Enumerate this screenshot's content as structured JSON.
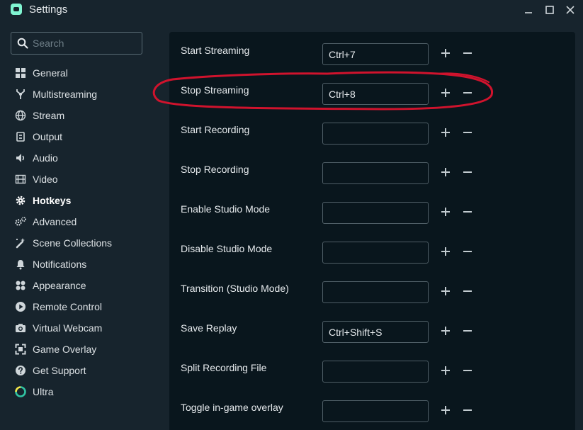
{
  "window": {
    "title": "Settings",
    "icons": {
      "app": "streamlabs-logo-icon",
      "minimize": "minimize-icon",
      "maximize": "maximize-icon",
      "close": "close-icon"
    }
  },
  "search": {
    "placeholder": "Search",
    "value": "",
    "icon": "search-icon"
  },
  "sidebar": {
    "active": "Hotkeys",
    "items": [
      {
        "label": "General",
        "icon": "grid-icon"
      },
      {
        "label": "Multistreaming",
        "icon": "fork-icon"
      },
      {
        "label": "Stream",
        "icon": "globe-icon"
      },
      {
        "label": "Output",
        "icon": "output-icon"
      },
      {
        "label": "Audio",
        "icon": "speaker-icon"
      },
      {
        "label": "Video",
        "icon": "film-icon"
      },
      {
        "label": "Hotkeys",
        "icon": "gear-icon"
      },
      {
        "label": "Advanced",
        "icon": "gears-icon"
      },
      {
        "label": "Scene Collections",
        "icon": "magic-wand-icon"
      },
      {
        "label": "Notifications",
        "icon": "bell-icon"
      },
      {
        "label": "Appearance",
        "icon": "palette-icon"
      },
      {
        "label": "Remote Control",
        "icon": "play-circle-icon"
      },
      {
        "label": "Virtual Webcam",
        "icon": "camera-icon"
      },
      {
        "label": "Game Overlay",
        "icon": "expand-icon"
      },
      {
        "label": "Get Support",
        "icon": "question-icon"
      },
      {
        "label": "Ultra",
        "icon": "ultra-icon"
      }
    ]
  },
  "hotkeys": [
    {
      "label": "Start Streaming",
      "value": "Ctrl+7"
    },
    {
      "label": "Stop Streaming",
      "value": "Ctrl+8"
    },
    {
      "label": "Start Recording",
      "value": ""
    },
    {
      "label": "Stop Recording",
      "value": ""
    },
    {
      "label": "Enable Studio Mode",
      "value": ""
    },
    {
      "label": "Disable Studio Mode",
      "value": ""
    },
    {
      "label": "Transition (Studio Mode)",
      "value": ""
    },
    {
      "label": "Save Replay",
      "value": "Ctrl+Shift+S"
    },
    {
      "label": "Split Recording File",
      "value": ""
    },
    {
      "label": "Toggle in-game overlay",
      "value": ""
    }
  ],
  "row_icons": {
    "add": "plus-icon",
    "remove": "minus-icon"
  },
  "colors": {
    "app_background": "#17242d",
    "panel_background": "#09161d",
    "accent": "#80f5d2",
    "annotation": "#d0132d",
    "ultra_green": "#31c3a2",
    "ultra_yellow": "#f5e84b"
  }
}
